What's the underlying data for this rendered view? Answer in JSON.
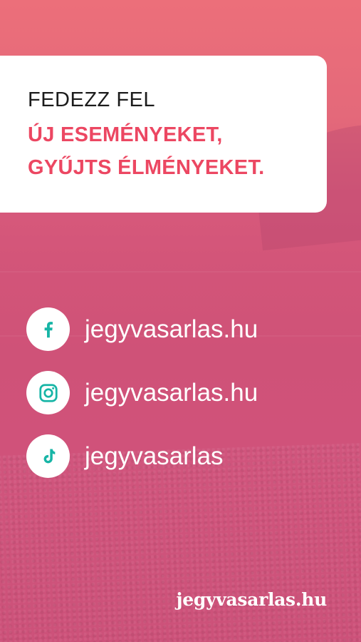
{
  "headline": {
    "line1": "FEDEZZ FEL",
    "line2": "ÚJ ESEMÉNYEKET,",
    "line3": "GYŰJTS ÉLMÉNYEKET."
  },
  "social": [
    {
      "icon": "facebook-icon",
      "label": "jegyvasarlas.hu"
    },
    {
      "icon": "instagram-icon",
      "label": "jegyvasarlas.hu"
    },
    {
      "icon": "tiktok-icon",
      "label": "jegyvasarlas"
    }
  ],
  "brand": "jegyvasarlas.hu",
  "colors": {
    "accent": "#ec4762",
    "icon": "#17b5a6",
    "background": "#d35579"
  }
}
